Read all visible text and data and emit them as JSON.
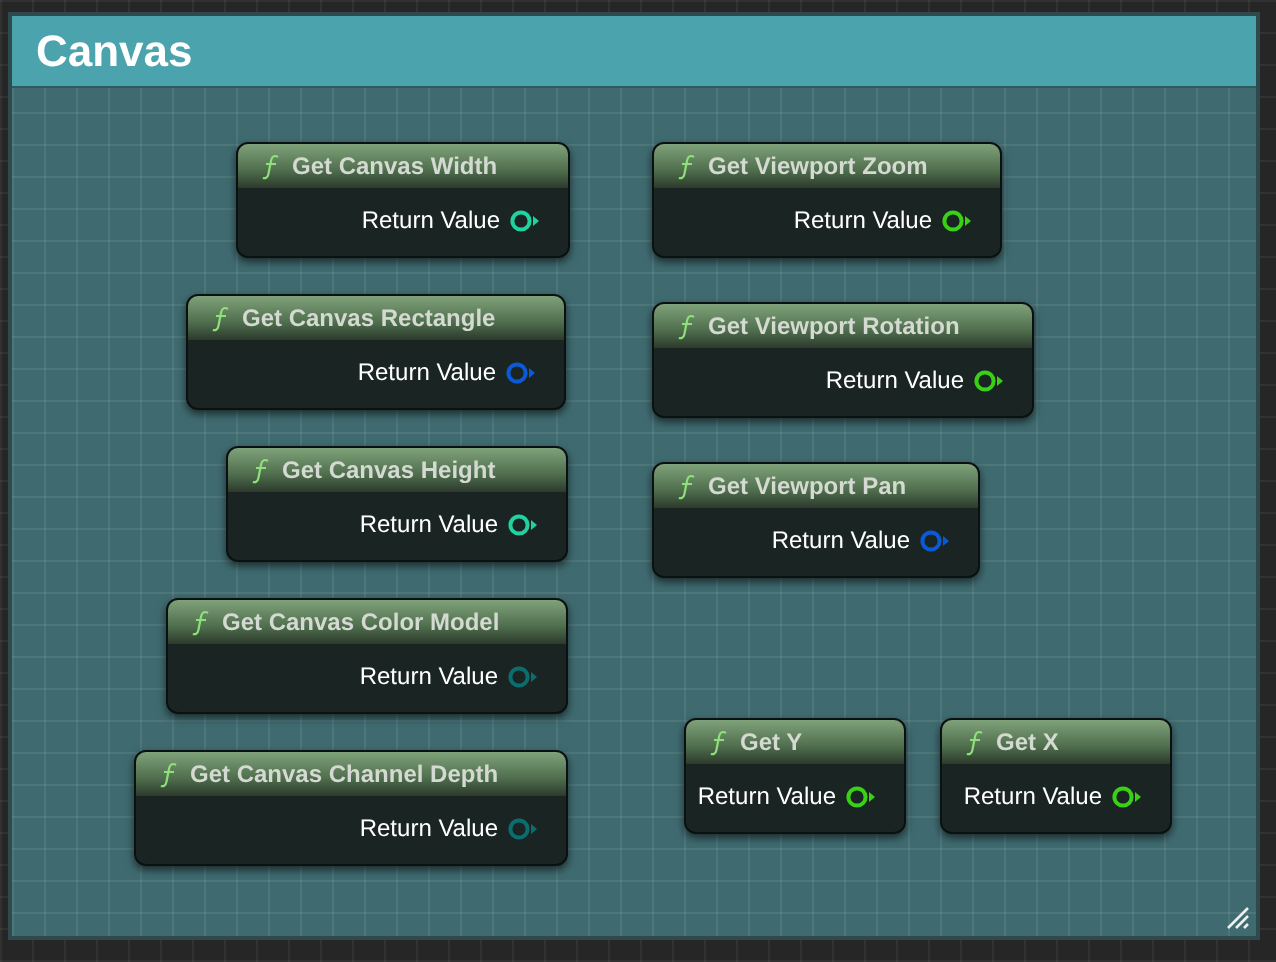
{
  "comment": {
    "title": "Canvas"
  },
  "nodes": [
    {
      "title": "Get Canvas Width",
      "output": "Return Value",
      "color": "#1fd2a0"
    },
    {
      "title": "Get Canvas Rectangle",
      "output": "Return Value",
      "color": "#0a5ad8"
    },
    {
      "title": "Get Canvas Height",
      "output": "Return Value",
      "color": "#1fd2a0"
    },
    {
      "title": "Get Canvas Color Model",
      "output": "Return Value",
      "color": "#0a6e6e"
    },
    {
      "title": "Get Canvas Channel Depth",
      "output": "Return Value",
      "color": "#0a6e6e"
    },
    {
      "title": "Get Viewport Zoom",
      "output": "Return Value",
      "color": "#3ad015"
    },
    {
      "title": "Get Viewport Rotation",
      "output": "Return Value",
      "color": "#3ad015"
    },
    {
      "title": "Get Viewport Pan",
      "output": "Return Value",
      "color": "#0a5ad8"
    },
    {
      "title": "Get Y",
      "output": "Return Value",
      "color": "#3ad015"
    },
    {
      "title": "Get X",
      "output": "Return Value",
      "color": "#3ad015"
    }
  ]
}
